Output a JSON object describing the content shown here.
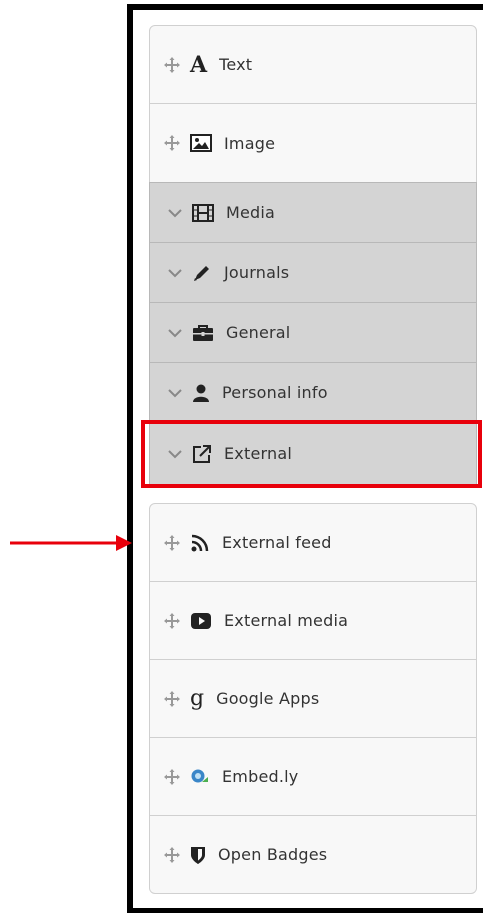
{
  "blocks_top": [
    {
      "label": "Text",
      "icon": "text-icon"
    },
    {
      "label": "Image",
      "icon": "image-icon"
    }
  ],
  "categories": [
    {
      "label": "Media",
      "icon": "film-icon"
    },
    {
      "label": "Journals",
      "icon": "pencil-icon"
    },
    {
      "label": "General",
      "icon": "briefcase-icon"
    },
    {
      "label": "Personal info",
      "icon": "user-icon"
    },
    {
      "label": "External",
      "icon": "external-link-icon"
    }
  ],
  "external_blocks": [
    {
      "label": "External feed",
      "icon": "rss-icon"
    },
    {
      "label": "External media",
      "icon": "video-play-icon"
    },
    {
      "label": "Google Apps",
      "icon": "google-icon"
    },
    {
      "label": "Embed.ly",
      "icon": "embedly-icon"
    },
    {
      "label": "Open Badges",
      "icon": "shield-icon"
    }
  ],
  "annotation": {
    "highlight_color": "#e8000b",
    "arrow_color": "#e8000b"
  }
}
